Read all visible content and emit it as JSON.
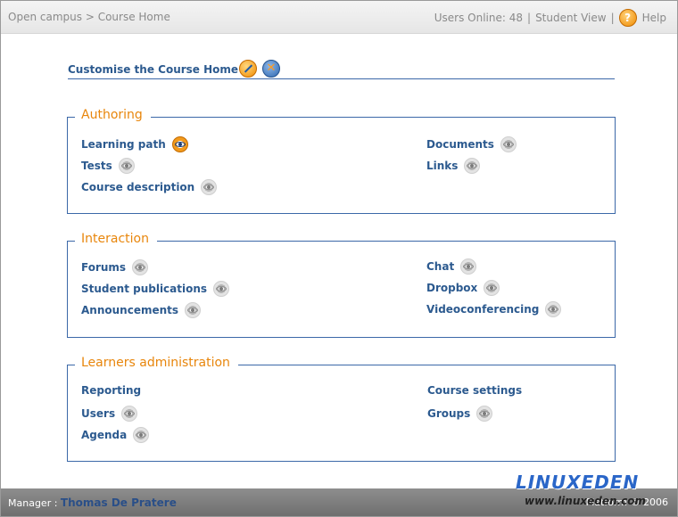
{
  "topbar": {
    "breadcrumb_root": "Open campus",
    "breadcrumb_sep": ">",
    "breadcrumb_current": "Course Home",
    "users_online": "Users Online: 48",
    "separator": "|",
    "student_view": "Student View",
    "help_label": "Help",
    "help_icon_glyph": "?"
  },
  "customise": {
    "title": "Customise the Course Home",
    "close_glyph": "✕"
  },
  "sections": {
    "authoring": {
      "title": "Authoring",
      "items": [
        "Learning path",
        "Documents",
        "Tests",
        "Links",
        "Course description"
      ]
    },
    "interaction": {
      "title": "Interaction",
      "items": [
        "Forums",
        "Chat",
        "Student publications",
        "Dropbox",
        "Announcements",
        "Videoconferencing"
      ]
    },
    "learners": {
      "title": "Learners administration",
      "items": [
        "Reporting",
        "Course settings",
        "Users",
        "Groups",
        "Agenda"
      ]
    }
  },
  "footer": {
    "manager_label": "Manager :",
    "manager_name": "Thomas De Pratere",
    "platform_text": "Platform",
    "copyright": "© 2006"
  },
  "watermark": {
    "logo": "LINUXEDEN",
    "url": "www.linuxeden.com"
  },
  "colors": {
    "link": "#2c5a8f",
    "section_title": "#e8860c",
    "border": "#3b68a8"
  }
}
